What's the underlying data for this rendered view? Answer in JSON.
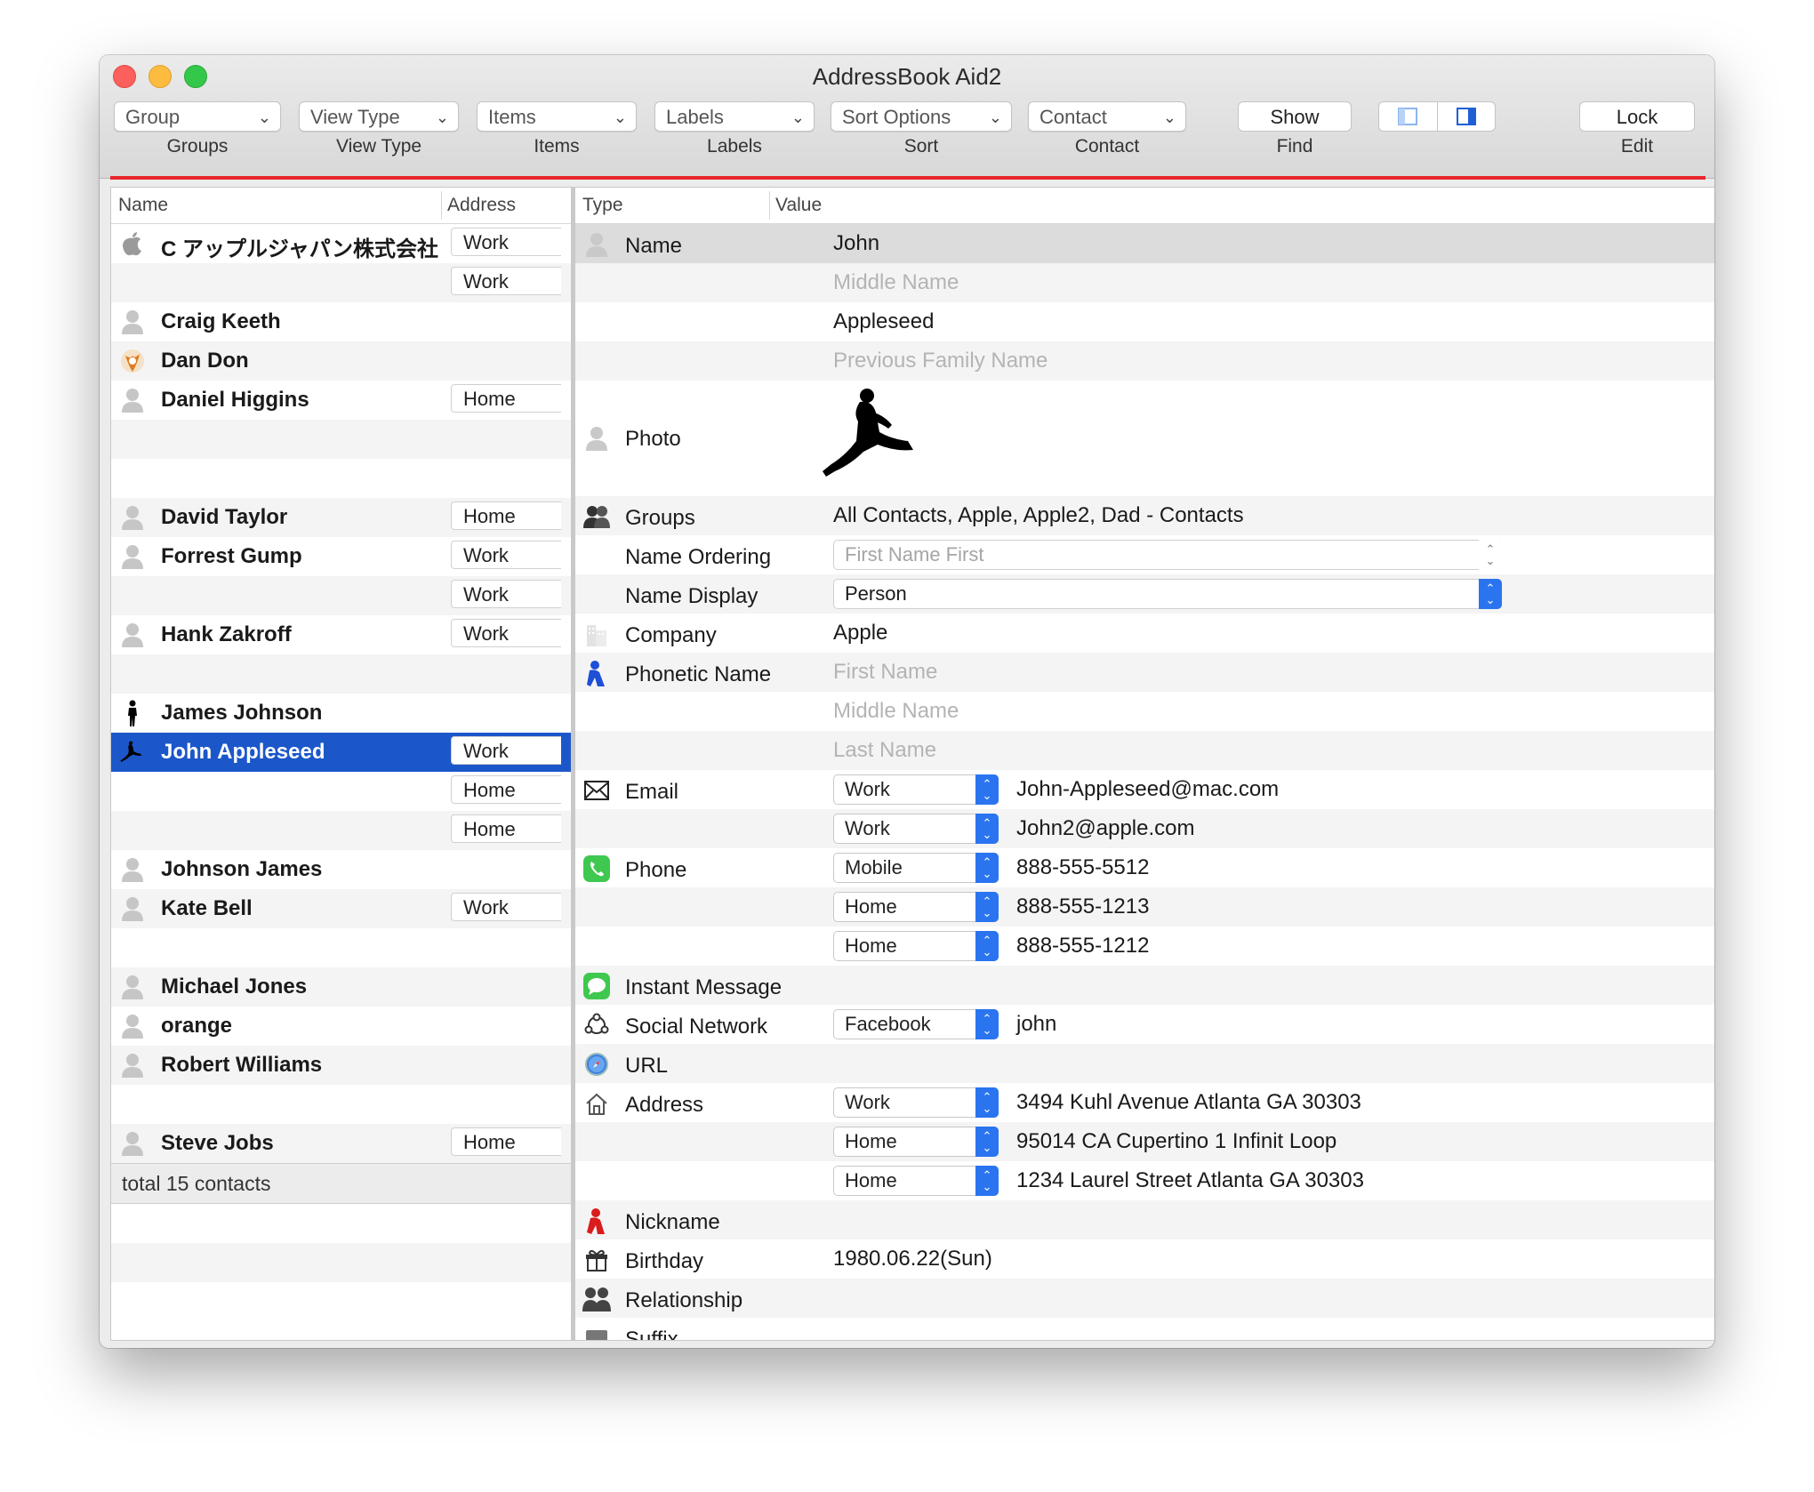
{
  "window": {
    "title": "AddressBook Aid2"
  },
  "toolbar": {
    "popups": [
      {
        "value": "Group",
        "label": "Groups"
      },
      {
        "value": "View Type",
        "label": "View Type"
      },
      {
        "value": "Items",
        "label": "Items"
      },
      {
        "value": "Labels",
        "label": "Labels"
      },
      {
        "value": "Sort Options",
        "label": "Sort"
      },
      {
        "value": "Contact",
        "label": "Contact"
      }
    ],
    "show_button": "Show",
    "show_caption": "Find",
    "lock_button": "Lock",
    "lock_caption": "Edit"
  },
  "contacts": {
    "headers": {
      "name": "Name",
      "address": "Address"
    },
    "rows": [
      {
        "name": "C アップルジャパン株式会社",
        "tag": "Work",
        "icon": "apple-logo-icon"
      },
      {
        "name": "",
        "tag": "Work"
      },
      {
        "name": "Craig Keeth",
        "tag": "",
        "icon": "person-icon"
      },
      {
        "name": "Dan Don",
        "tag": "",
        "icon": "avatar-photo-icon"
      },
      {
        "name": "Daniel Higgins",
        "tag": "Home",
        "icon": "person-icon"
      },
      {
        "name": "",
        "tag": ""
      },
      {
        "name": "",
        "tag": ""
      },
      {
        "name": "David Taylor",
        "tag": "Home",
        "icon": "person-icon"
      },
      {
        "name": "Forrest Gump",
        "tag": "Work",
        "icon": "person-icon"
      },
      {
        "name": "",
        "tag": "Work"
      },
      {
        "name": "Hank Zakroff",
        "tag": "Work",
        "icon": "person-icon"
      },
      {
        "name": "",
        "tag": ""
      },
      {
        "name": "James Johnson",
        "tag": "",
        "icon": "silhouette-icon"
      },
      {
        "name": "John Appleseed",
        "tag": "Work",
        "icon": "jumping-silhouette-icon",
        "selected": true
      },
      {
        "name": "",
        "tag": "Home"
      },
      {
        "name": "",
        "tag": "Home"
      },
      {
        "name": "Johnson James",
        "tag": "",
        "icon": "person-icon"
      },
      {
        "name": "Kate Bell",
        "tag": "Work",
        "icon": "person-icon"
      },
      {
        "name": "",
        "tag": ""
      },
      {
        "name": "Michael Jones",
        "tag": "",
        "icon": "person-icon"
      },
      {
        "name": "orange",
        "tag": "",
        "icon": "person-icon"
      },
      {
        "name": "Robert Williams",
        "tag": "",
        "icon": "person-icon"
      },
      {
        "name": "",
        "tag": ""
      },
      {
        "name": "Steve Jobs",
        "tag": "Home",
        "icon": "person-icon"
      }
    ],
    "total": "total 15 contacts"
  },
  "detail": {
    "headers": {
      "type": "Type",
      "value": "Value"
    },
    "name": {
      "type": "Name",
      "first": "John",
      "middle_ph": "Middle Name",
      "last": "Appleseed",
      "prev_family_ph": "Previous Family Name"
    },
    "photo": {
      "type": "Photo"
    },
    "groups": {
      "type": "Groups",
      "value": "All Contacts, Apple, Apple2, Dad - Contacts"
    },
    "name_ordering": {
      "type": "Name Ordering",
      "value": "First Name First"
    },
    "name_display": {
      "type": "Name Display",
      "value": "Person"
    },
    "company": {
      "type": "Company",
      "value": "Apple"
    },
    "phonetic": {
      "type": "Phonetic Name",
      "first_ph": "First Name",
      "middle_ph": "Middle Name",
      "last_ph": "Last Name"
    },
    "email": {
      "type": "Email",
      "entries": [
        {
          "label": "Work",
          "value": "John-Appleseed@mac.com"
        },
        {
          "label": "Work",
          "value": "John2@apple.com"
        }
      ]
    },
    "phone": {
      "type": "Phone",
      "entries": [
        {
          "label": "Mobile",
          "value": "888-555-5512"
        },
        {
          "label": "Home",
          "value": "888-555-1213"
        },
        {
          "label": "Home",
          "value": "888-555-1212"
        }
      ]
    },
    "im": {
      "type": "Instant Message"
    },
    "social": {
      "type": "Social Network",
      "label": "Facebook",
      "value": "john"
    },
    "url": {
      "type": "URL"
    },
    "address": {
      "type": "Address",
      "entries": [
        {
          "label": "Work",
          "value": "3494 Kuhl Avenue Atlanta GA 30303"
        },
        {
          "label": "Home",
          "value": "95014 CA Cupertino 1 Infinit Loop"
        },
        {
          "label": "Home",
          "value": "1234 Laurel Street Atlanta GA 30303"
        }
      ]
    },
    "nickname": {
      "type": "Nickname"
    },
    "birthday": {
      "type": "Birthday",
      "value": "1980.06.22(Sun)"
    },
    "relationship": {
      "type": "Relationship"
    },
    "suffix": {
      "type": "Suffix"
    }
  },
  "colors": {
    "selection": "#1b57c9",
    "accent_line": "#e8262b",
    "stepper": "#2a74f0"
  }
}
